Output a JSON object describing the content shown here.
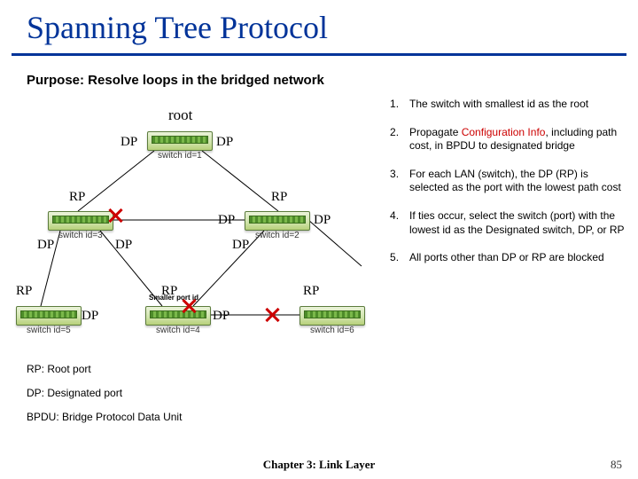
{
  "title": "Spanning Tree Protocol",
  "purpose": "Purpose: Resolve loops in the bridged network",
  "rootLabel": "root",
  "portLabels": {
    "dp": "DP",
    "rp": "RP"
  },
  "smallerNote": "Smaller port id",
  "switches": {
    "s1": "switch id=1",
    "s2": "switch id=2",
    "s3": "switch id=3",
    "s4": "switch id=4",
    "s5": "switch id=5",
    "s6": "switch id=6"
  },
  "steps": [
    {
      "text": "The switch with smallest id as the root"
    },
    {
      "prefix": "Propagate ",
      "highlight": "Configuration Info",
      "suffix": ", including path cost, in BPDU to designated bridge"
    },
    {
      "text": "For each LAN (switch), the DP (RP) is selected as the port with the lowest path cost"
    },
    {
      "text": "If ties occur, select the switch (port) with the lowest id as the Designated switch, DP, or RP"
    },
    {
      "text": "All ports other than DP or RP are blocked"
    }
  ],
  "legend": {
    "rp": "RP: Root port",
    "dp": "DP: Designated port",
    "bpdu": "BPDU: Bridge Protocol Data Unit"
  },
  "footer": "Chapter 3: Link Layer",
  "pageNumber": "85"
}
